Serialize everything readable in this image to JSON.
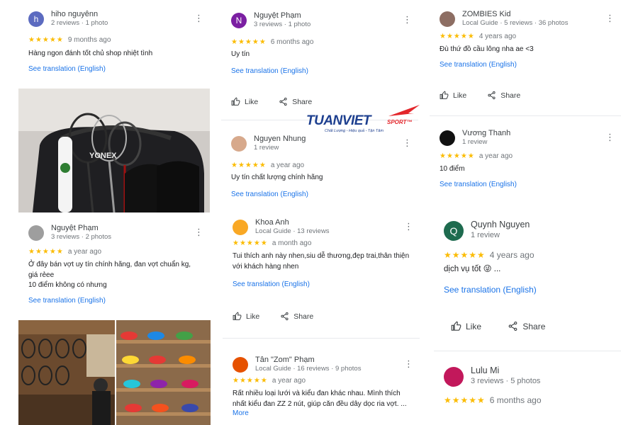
{
  "logo": {
    "main": "TUANVIET",
    "sport": "SPORT™",
    "tagline": "Chất Lượng - Hiệu quả - Tận Tâm"
  },
  "actions": {
    "like": "Like",
    "share": "Share"
  },
  "translate_label": "See translation (English)",
  "more_label": "More",
  "stars": "★★★★★",
  "reviews": [
    {
      "id": "hiho",
      "initial": "h",
      "avatar_color": "#5c6bc0",
      "name": "hiho nguyênn",
      "meta": "2 reviews · 1 photo",
      "when": "9 months ago",
      "text": "Hàng ngon đánh tốt chủ shop nhiệt tình"
    },
    {
      "id": "nguyet1",
      "initial": "N",
      "avatar_color": "#7b1fa2",
      "name": "Nguyệt Phạm",
      "meta": "3 reviews · 1 photo",
      "when": "6 months ago",
      "text": "Uy tín"
    },
    {
      "id": "zombies",
      "initial": "",
      "avatar_color": "#8d6e63",
      "name": "ZOMBIES Kid",
      "meta": "Local Guide · 5 reviews · 36 photos",
      "when": "4 years ago",
      "text": "Đù thứ đồ cầu lông nha ae <3"
    },
    {
      "id": "nhung",
      "initial": "",
      "avatar_color": "#d7a98c",
      "name": "Nguyen Nhung",
      "meta": "1 review",
      "when": "a year ago",
      "text": "Uy tín chất lượng chính hãng"
    },
    {
      "id": "vuong",
      "initial": "",
      "avatar_color": "#111111",
      "name": "Vương Thanh",
      "meta": "1 review",
      "when": "a year ago",
      "text": "10 điểm"
    },
    {
      "id": "nguyet2",
      "initial": "",
      "avatar_color": "#9e9e9e",
      "name": "Nguyệt Phạm",
      "meta": "3 reviews · 2 photos",
      "when": "a year ago",
      "text": "Ở đây bán vợt uy tín chính hãng, đan vợt chuẩn kg, giá rẻee",
      "text2": "10 điểm không có nhưng"
    },
    {
      "id": "khoa",
      "initial": "",
      "avatar_color": "#f9a825",
      "name": "Khoa Anh",
      "meta": "Local Guide · 13 reviews",
      "when": "a month ago",
      "text": "Tui thích anh này nhen,siu dễ thương,đẹp trai,thân thiện với khách hàng nhen"
    },
    {
      "id": "quynh",
      "initial": "Q",
      "avatar_color": "#1e6b4f",
      "name": "Quynh Nguyen",
      "meta": "1 review",
      "when": "4 years ago",
      "text": "dịch vụ tốt 😜 ..."
    },
    {
      "id": "tan",
      "initial": "",
      "avatar_color": "#e65100",
      "name": "Tân \"Zom\" Phạm",
      "meta": "Local Guide · 16 reviews · 9 photos",
      "when": "a year ago",
      "text": "Rất nhiều loại lưới và kiểu đan khác nhau. Mình thích nhất kiểu đan ZZ 2 nút, giúp căn đều dây dọc ria vợt. ..."
    },
    {
      "id": "lulu",
      "initial": "",
      "avatar_color": "#c2185b",
      "name": "Lulu Mi",
      "meta": "3 reviews · 5 photos",
      "when": "6 months ago",
      "text": ""
    }
  ]
}
